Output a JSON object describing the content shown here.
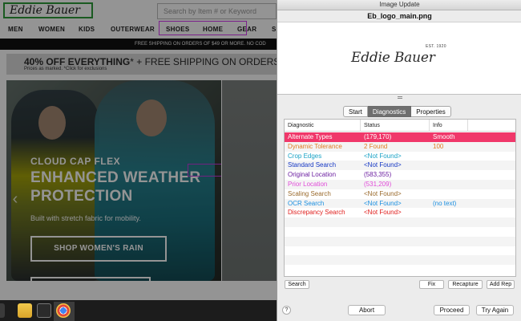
{
  "website": {
    "logo_text": "Eddie Bauer",
    "search_placeholder": "Search by Item # or Keyword",
    "nav": [
      "MEN",
      "WOMEN",
      "KIDS",
      "OUTERWEAR",
      "SHOES",
      "HOME",
      "GEAR",
      "S"
    ],
    "shipping_bar": "FREE SHIPPING ON ORDERS OF $49 OR MORE. NO COD",
    "promo": {
      "bold": "40% OFF EVERYTHING",
      "rest": "* + FREE SHIPPING ON ORDERS OF $",
      "sub": "Prices as marked.   *Click for exclusions"
    },
    "hero": {
      "kicker": "CLOUD CAP FLEX",
      "title": "ENHANCED WEATHER PROTECTION",
      "subtitle": "Built with stretch fabric for mobility.",
      "cta": "SHOP WOMEN'S RAIN",
      "prev_arrow": "‹"
    }
  },
  "taskbar": {
    "icons": [
      "start-icon",
      "file-explorer-icon",
      "store-icon",
      "chrome-icon"
    ]
  },
  "dialog": {
    "window_title": "Image Update",
    "filename": "Eb_logo_main.png",
    "preview": {
      "logo_text": "Eddie Bauer",
      "est_text": "EST. 1920"
    },
    "tabs": [
      "Start",
      "Diagnostics",
      "Properties"
    ],
    "active_tab": "Diagnostics",
    "columns": [
      "Diagnostic",
      "Status",
      "Info"
    ],
    "rows": [
      {
        "diagnostic": "Alternate Types",
        "status": "(179,170)",
        "info": "Smooth",
        "color": "#ffffff",
        "selected": true
      },
      {
        "diagnostic": "Dynamic Tolerance",
        "status": "2 Found",
        "info": "100",
        "color": "#e07b22"
      },
      {
        "diagnostic": "Crop Edges",
        "status": "<Not Found>",
        "info": "",
        "color": "#1aa3c6"
      },
      {
        "diagnostic": "Standard Search",
        "status": "<Not Found>",
        "info": "",
        "color": "#1537c4"
      },
      {
        "diagnostic": "Original Location",
        "status": "(583,355)",
        "info": "",
        "color": "#6b1ea0"
      },
      {
        "diagnostic": "Prior Location",
        "status": "(531,209)",
        "info": "",
        "color": "#e04bd8"
      },
      {
        "diagnostic": "Scaling Search",
        "status": "<Not Found>",
        "info": "",
        "color": "#9a6a2c"
      },
      {
        "diagnostic": "OCR Search",
        "status": "<Not Found>",
        "info": "(no text)",
        "color": "#1b8fe0"
      },
      {
        "diagnostic": "Discrepancy Search",
        "status": "<Not Found>",
        "info": "",
        "color": "#e0201e"
      }
    ],
    "empty_rows": 6,
    "panel_buttons": {
      "search": "Search",
      "fix": "Fix",
      "recapture": "Recapture",
      "add_rep": "Add Rep"
    },
    "footer_buttons": {
      "help": "?",
      "abort": "Abort",
      "proceed": "Proceed",
      "try_again": "Try Again"
    },
    "colors": {
      "selected_row": "#f0376a",
      "active_tab": "#6e6e6e"
    }
  }
}
